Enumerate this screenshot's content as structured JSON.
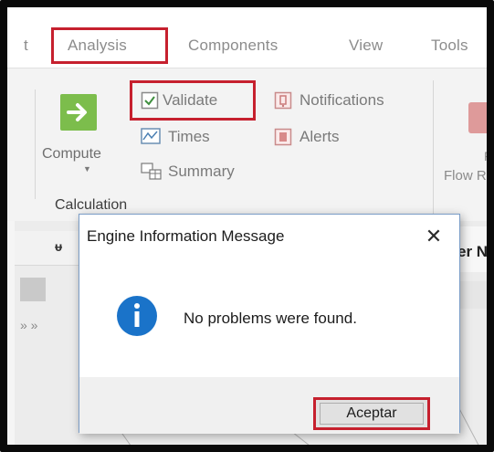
{
  "menu": {
    "items": [
      "t",
      "Analysis",
      "Components",
      "View",
      "Tools"
    ],
    "highlighted": "Analysis"
  },
  "ribbon": {
    "compute_label": "Compute",
    "validate_label": "Validate",
    "times_label": "Times",
    "summary_label": "Summary",
    "notifications_label": "Notifications",
    "alerts_label": "Alerts",
    "group_label": "Calculation",
    "flow_f": "F",
    "flow_label": "Flow R"
  },
  "background": {
    "right_pane_title": "er No"
  },
  "dialog": {
    "title": "Engine Information Message",
    "close_symbol": "✕",
    "message": "No problems were found.",
    "ok_label": "Aceptar"
  },
  "colors": {
    "highlight": "#c6202e",
    "info_blue": "#1a73c9",
    "compute_green": "#7cbd4c"
  }
}
